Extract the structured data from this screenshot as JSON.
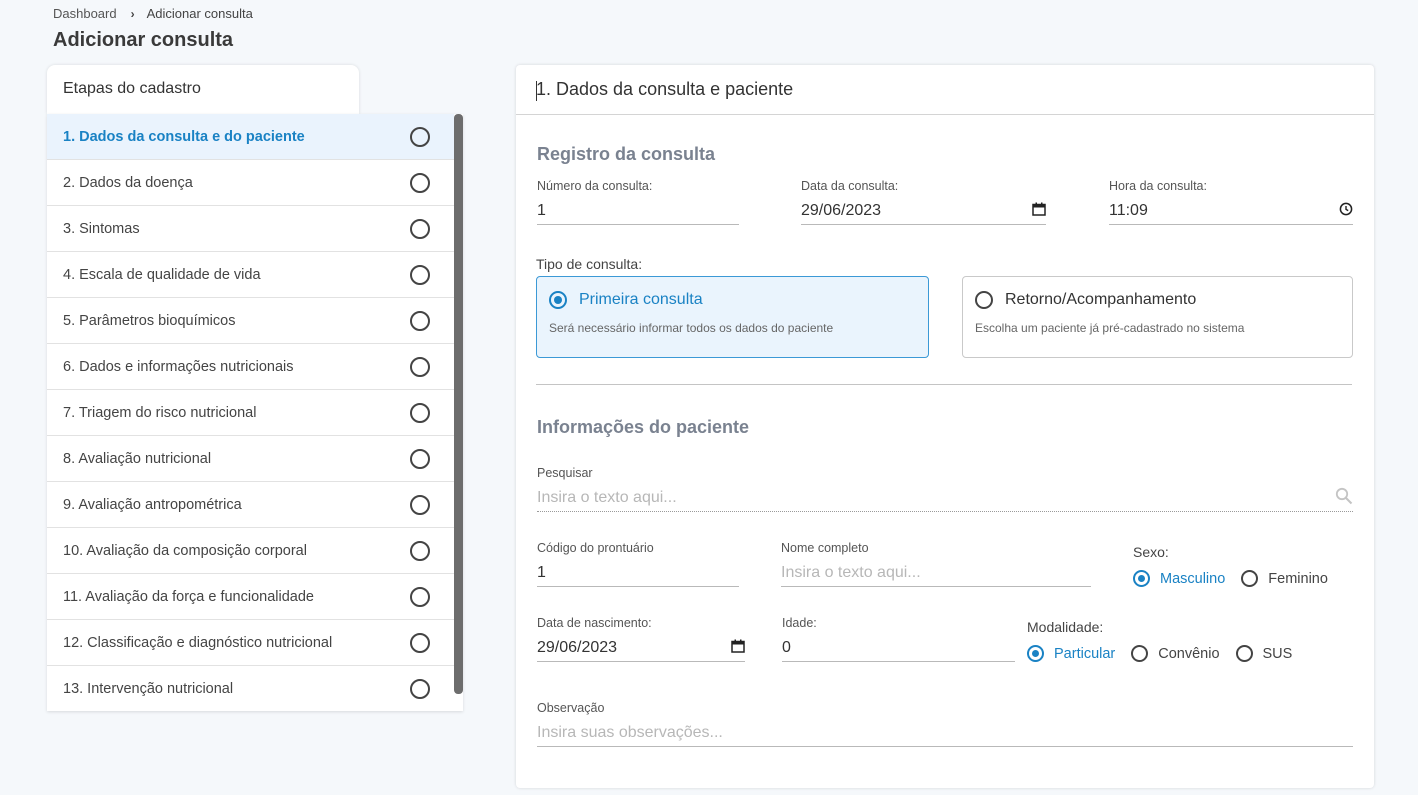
{
  "breadcrumb": {
    "home": "Dashboard",
    "separator": "›",
    "current": "Adicionar consulta"
  },
  "page_title": "Adicionar consulta",
  "steps": {
    "title": "Etapas do cadastro",
    "items": [
      {
        "label": "1. Dados da consulta e do paciente",
        "active": true
      },
      {
        "label": "2. Dados da doença"
      },
      {
        "label": "3. Sintomas"
      },
      {
        "label": "4. Escala de qualidade de vida"
      },
      {
        "label": "5. Parâmetros bioquímicos"
      },
      {
        "label": "6. Dados e informações nutricionais"
      },
      {
        "label": "7. Triagem do risco nutricional"
      },
      {
        "label": "8. Avaliação nutricional"
      },
      {
        "label": "9. Avaliação antropométrica"
      },
      {
        "label": "10. Avaliação da composição corporal"
      },
      {
        "label": "11. Avaliação da força e funcionalidade"
      },
      {
        "label": "12. Classificação e diagnóstico nutricional"
      },
      {
        "label": "13. Intervenção nutricional"
      }
    ]
  },
  "form": {
    "header": "1. Dados da consulta e paciente",
    "registro": {
      "title": "Registro da consulta",
      "numero_label": "Número da consulta:",
      "numero_value": "1",
      "data_label": "Data da consulta:",
      "data_value": "29/06/2023",
      "hora_label": "Hora da consulta:",
      "hora_value": "11:09"
    },
    "tipo": {
      "label": "Tipo de consulta:",
      "primeira_title": "Primeira consulta",
      "primeira_desc": "Será necessário informar todos os dados do paciente",
      "retorno_title": "Retorno/Acompanhamento",
      "retorno_desc": "Escolha um paciente já pré-cadastrado no sistema",
      "selected": "primeira"
    },
    "paciente": {
      "title": "Informações do paciente",
      "pesquisar_label": "Pesquisar",
      "pesquisar_placeholder": "Insira o texto aqui...",
      "codigo_label": "Código do prontuário",
      "codigo_value": "1",
      "nome_label": "Nome completo",
      "nome_placeholder": "Insira o texto aqui...",
      "sexo_label": "Sexo:",
      "sexo_options": [
        "Masculino",
        "Feminino"
      ],
      "sexo_selected": "Masculino",
      "nascimento_label": "Data de nascimento:",
      "nascimento_value": "29/06/2023",
      "idade_label": "Idade:",
      "idade_value": "0",
      "modalidade_label": "Modalidade:",
      "modalidade_options": [
        "Particular",
        "Convênio",
        "SUS"
      ],
      "modalidade_selected": "Particular",
      "obs_label": "Observação",
      "obs_placeholder": "Insira suas observações..."
    }
  },
  "icons": {
    "calendar": "calendar-icon",
    "clock": "clock-icon",
    "search": "search-icon",
    "chevron": "chevron-right-icon"
  },
  "colors": {
    "accent": "#1a82c4",
    "active_bg": "#eaf3fd"
  }
}
